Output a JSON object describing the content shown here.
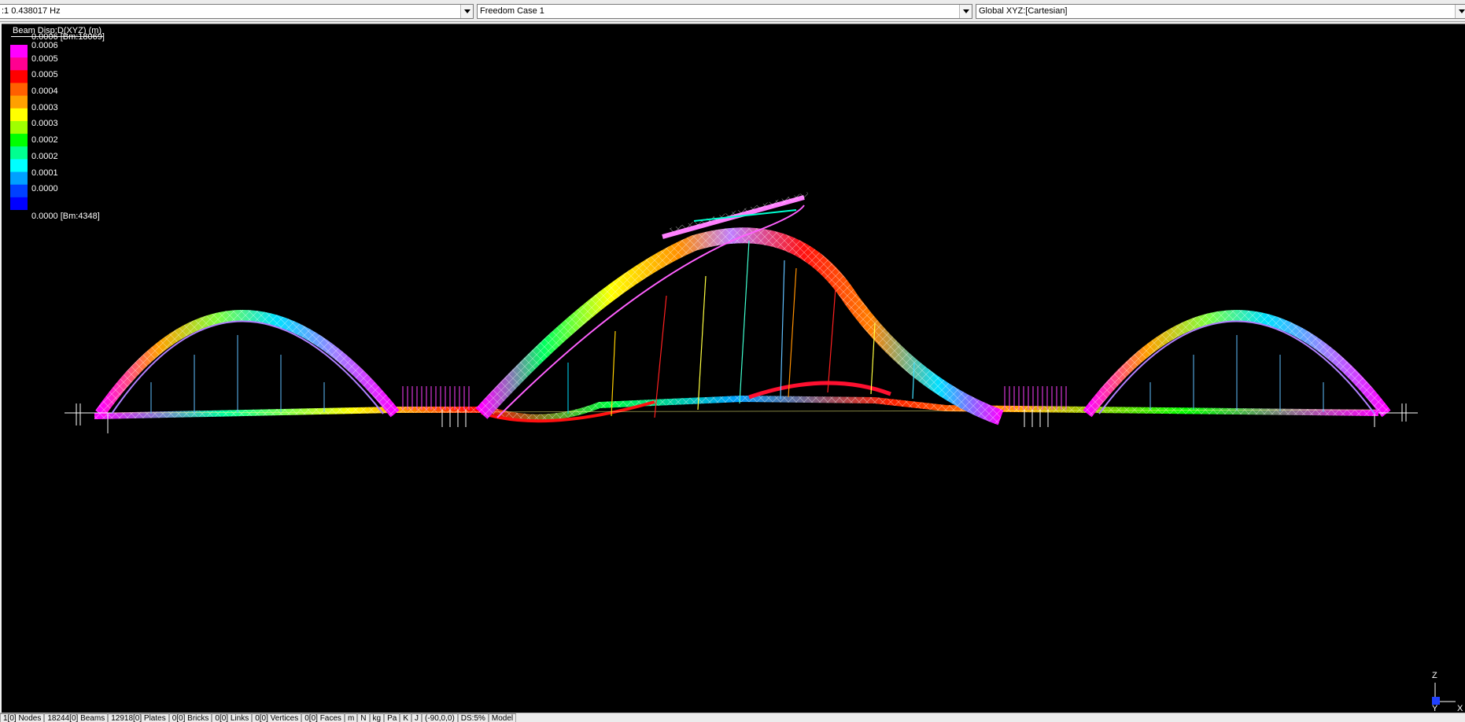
{
  "toolbar": {
    "mode_value": ":1  0.438017 Hz",
    "case_value": "Freedom Case 1",
    "coord_value": "Global XYZ:[Cartesian]"
  },
  "legend": {
    "title": "Beam Disp:D(XYZ) (m)",
    "max_label": "0.0006 [Bm:18069]",
    "min_label": "0.0000 [Bm:4348]",
    "labels": [
      "0.0006",
      "0.0005",
      "0.0005",
      "0.0004",
      "0.0003",
      "0.0003",
      "0.0002",
      "0.0002",
      "0.0001",
      "0.0000"
    ],
    "colors": [
      "#ff00ff",
      "#ff0090",
      "#ff0000",
      "#ff6000",
      "#ffa000",
      "#ffff00",
      "#a0ff00",
      "#00ff00",
      "#00ff90",
      "#00ffff",
      "#00a0ff",
      "#0040ff",
      "#0000ff"
    ]
  },
  "axes": {
    "z": "Z",
    "y": "Y",
    "x": "X"
  },
  "status": {
    "nodes": "1[0] Nodes",
    "beams": "18244[0] Beams",
    "plates": "12918[0] Plates",
    "bricks": "0[0] Bricks",
    "links": "0[0] Links",
    "vertices": "0[0] Vertices",
    "faces": "0[0] Faces",
    "unit_length": "m",
    "unit_force": "N",
    "unit_mass": "kg",
    "unit_stress": "Pa",
    "unit_temp": "K",
    "unit_time": "J",
    "view_angles": "(-90,0,0)",
    "ds": "DS:5%",
    "mode": "Model"
  }
}
